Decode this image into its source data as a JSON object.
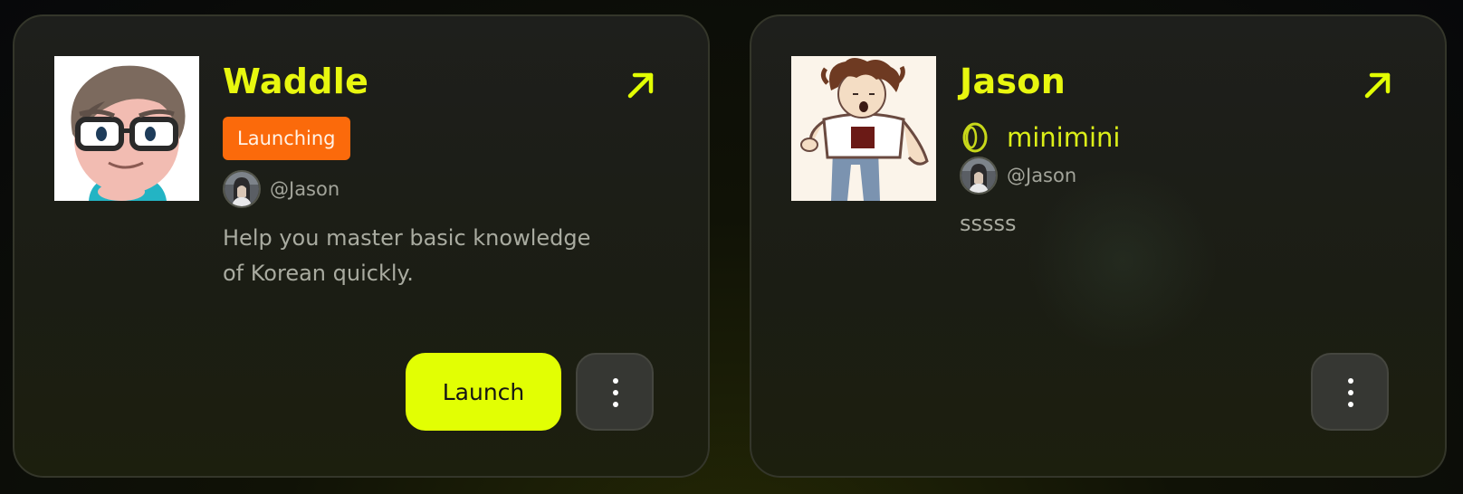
{
  "cards": [
    {
      "title": "Waddle",
      "badge": "Launching",
      "author": "@Jason",
      "description": "Help you master basic knowledge of Korean quickly.",
      "launch_label": "Launch",
      "thumbnail_icon": "cartoon-man-with-glasses",
      "open_icon": "arrow-up-right-icon",
      "more_icon": "vertical-dots-icon"
    },
    {
      "title": "Jason",
      "token": "minimini",
      "token_icon": "coin-icon",
      "author": "@Jason",
      "description": "sssss",
      "thumbnail_icon": "cartoon-boy-drawing",
      "open_icon": "arrow-up-right-icon",
      "more_icon": "vertical-dots-icon"
    }
  ],
  "colors": {
    "accent": "#e2ff03",
    "badge": "#fb6a0b",
    "card_background": "#1e1f1c",
    "text_secondary": "#a9aba0"
  }
}
